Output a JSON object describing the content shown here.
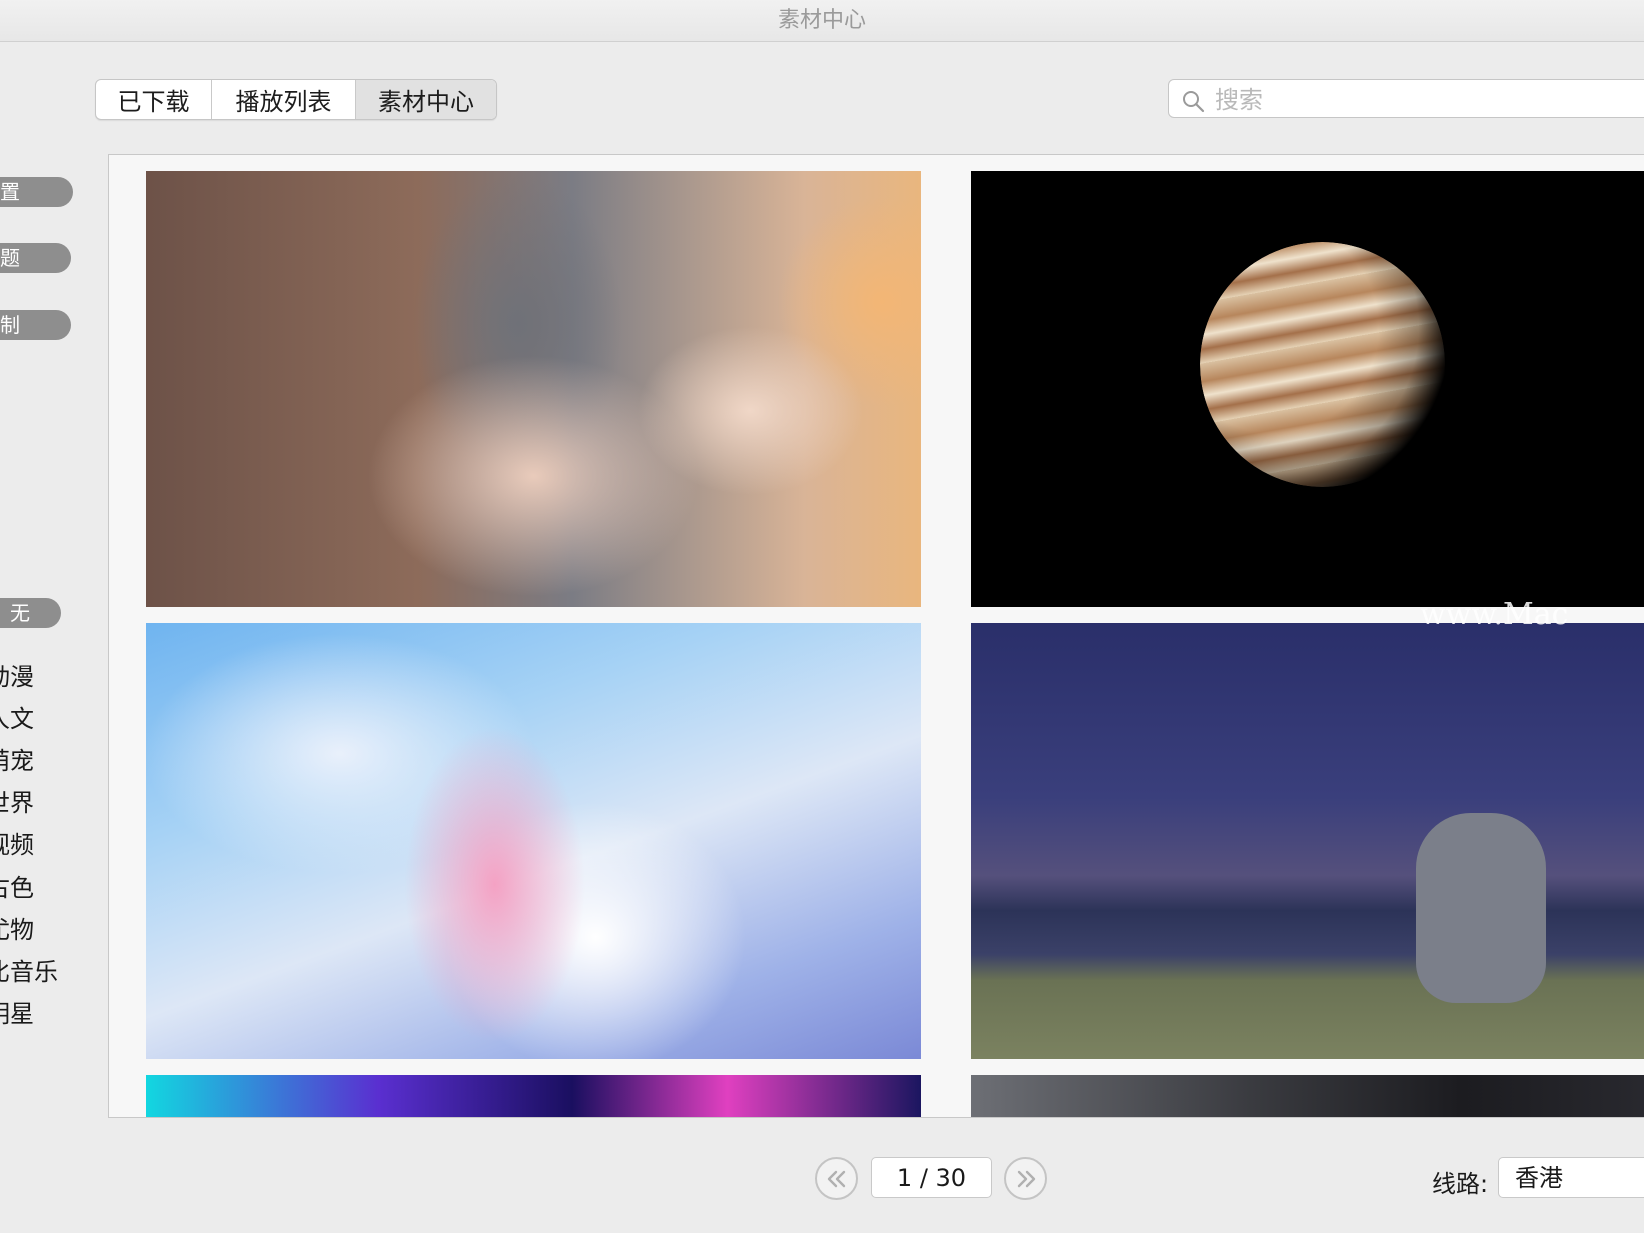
{
  "window": {
    "title": "素材中心"
  },
  "tabs": [
    {
      "label": "已下载"
    },
    {
      "label": "播放列表"
    },
    {
      "label": "素材中心"
    }
  ],
  "search": {
    "placeholder": "搜索",
    "value": ""
  },
  "sidebar": {
    "pills": [
      "置",
      "题",
      "制"
    ],
    "filter_pill": "无",
    "categories": [
      "动漫",
      "人文",
      "萌宠",
      "世界",
      "视频",
      "古色",
      "尤物",
      "比音乐",
      "明星"
    ]
  },
  "watermark": "www.Mac",
  "pagination": {
    "page_text": "1 / 30"
  },
  "route": {
    "label": "线路:",
    "value": "香港"
  },
  "colors": {
    "background": "#ececec",
    "pill": "#8e8e8e",
    "border": "#c6c6c6"
  },
  "icons": {
    "search": "search-icon",
    "prev": "chevron-double-left-icon",
    "next": "chevron-double-right-icon"
  }
}
